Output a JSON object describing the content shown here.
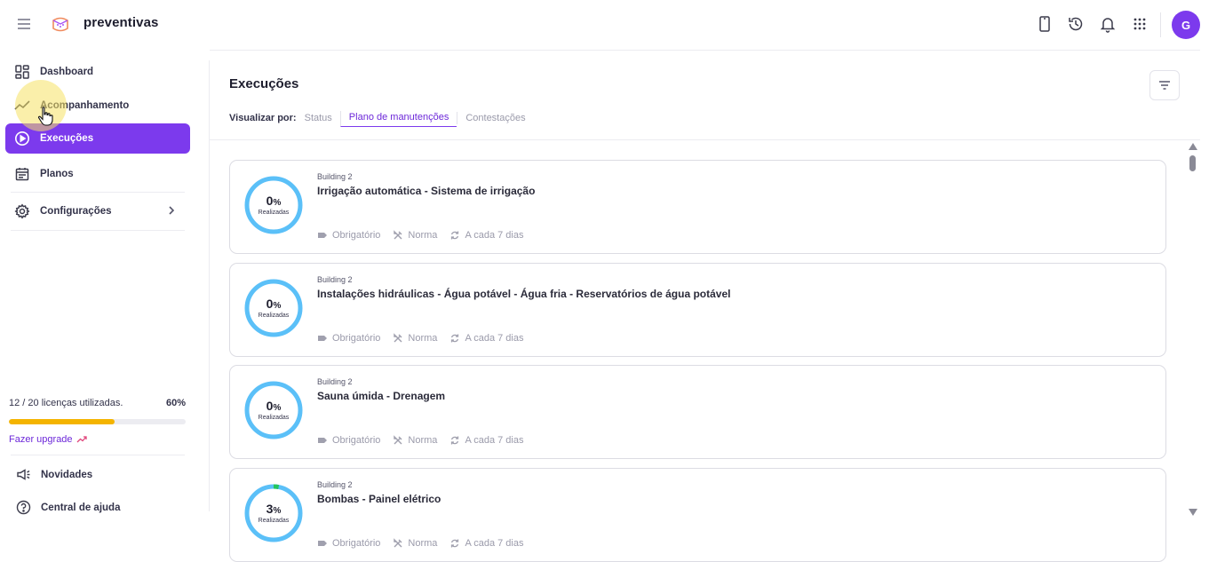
{
  "app": {
    "brand": "preventivas"
  },
  "header": {
    "icons": [
      "menu-icon",
      "logo-icon",
      "mobile-icon",
      "history-icon",
      "bell-icon",
      "apps-grid-icon"
    ],
    "avatar_initial": "G",
    "accent": "#7c3aed"
  },
  "sidebar": {
    "items": [
      {
        "label": "Dashboard",
        "icon": "dashboard-icon"
      },
      {
        "label": "Acompanhamento",
        "icon": "trend-line-icon"
      },
      {
        "label": "Execuções",
        "icon": "play-circle-icon",
        "active": true
      },
      {
        "label": "Planos",
        "icon": "calendar-icon"
      },
      {
        "label": "Configurações",
        "icon": "gear-icon"
      }
    ],
    "license": {
      "text": "12 / 20 licenças utilizadas.",
      "percent_label": "60%",
      "fraction": 0.6,
      "bar_color": "#f4b400"
    },
    "upgrade_label": "Fazer upgrade",
    "footer": [
      {
        "label": "Novidades",
        "icon": "megaphone-icon"
      },
      {
        "label": "Central de ajuda",
        "icon": "help-circle-icon"
      }
    ]
  },
  "main": {
    "title": "Execuções",
    "view_by_label": "Visualizar por:",
    "tabs": [
      {
        "label": "Status",
        "active": false
      },
      {
        "label": "Plano de manutenções",
        "active": true
      },
      {
        "label": "Contestações",
        "active": false
      }
    ],
    "cards": [
      {
        "building": "Building 2",
        "title": "Irrigação automática - Sistema de irrigação",
        "percent": 0,
        "percent_label": "0",
        "done_label": "Realizadas",
        "tags": [
          "Obrigatório",
          "Norma",
          "A cada 7 dias"
        ]
      },
      {
        "building": "Building 2",
        "title": "Instalações hidráulicas - Água potável - Água fria - Reservatórios de água potável",
        "percent": 0,
        "percent_label": "0",
        "done_label": "Realizadas",
        "tags": [
          "Obrigatório",
          "Norma",
          "A cada 7 dias"
        ]
      },
      {
        "building": "Building 2",
        "title": "Sauna úmida - Drenagem",
        "percent": 0,
        "percent_label": "0",
        "done_label": "Realizadas",
        "tags": [
          "Obrigatório",
          "Norma",
          "A cada 7 dias"
        ]
      },
      {
        "building": "Building 2",
        "title": "Bombas - Painel elétrico",
        "percent": 3,
        "percent_label": "3",
        "done_label": "Realizadas",
        "tags": [
          "Obrigatório",
          "Norma",
          "A cada 7 dias"
        ]
      }
    ],
    "pct_sign": "%",
    "ring_color": "#5bc0f8",
    "progress_color": "#22c55e"
  }
}
